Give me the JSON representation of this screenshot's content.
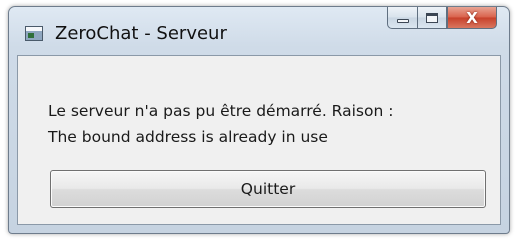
{
  "window": {
    "title": "ZeroChat - Serveur"
  },
  "caption_buttons": {
    "minimize_icon": "minimize-icon",
    "maximize_icon": "maximize-icon",
    "close_label": "X"
  },
  "dialog": {
    "message_line1": "Le serveur n'a pas pu être démarré. Raison :",
    "message_line2": "The bound address is already in use",
    "quit_button_label": "Quitter"
  },
  "colors": {
    "frame": "#cfdbe8",
    "close_button": "#c7402a",
    "client_background": "#f0f0f0"
  }
}
